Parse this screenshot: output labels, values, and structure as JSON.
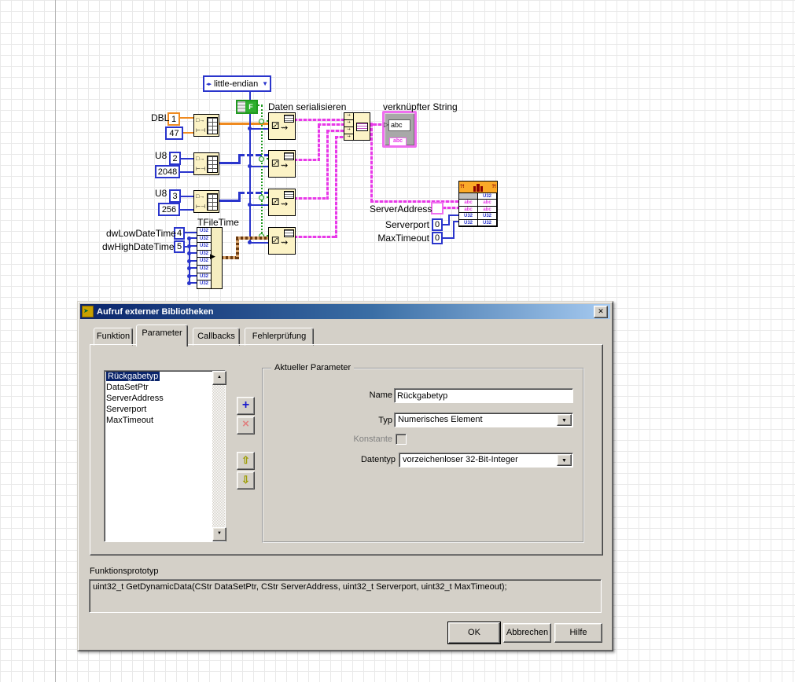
{
  "diagram": {
    "enum_value": "little-endian",
    "bool_value": "F",
    "labels": {
      "serialize": "Daten serialisieren",
      "indicator": "verknüpfter String",
      "cluster": "TFileTime",
      "dbl": "DBL",
      "u8_a": "U8",
      "u8_b": "U8",
      "low": "dwLowDateTime",
      "high": "dwHighDateTime",
      "server_address": "ServerAddress",
      "serverport": "Serverport",
      "max_timeout": "MaxTimeout"
    },
    "constants": {
      "idx1": "1",
      "val1": "47",
      "idx2": "2",
      "val2": "2048",
      "idx3": "3",
      "val3": "256",
      "idx4": "4",
      "idx5": "5",
      "serverport": "0",
      "max_timeout": "0"
    },
    "cluster_cell": "U32",
    "indicator": {
      "value": "abc",
      "tag": "abc"
    },
    "clfn": {
      "marks_left": "?!",
      "marks_right": "?!",
      "cells": [
        [
          "",
          "U32"
        ],
        [
          "abc",
          "abc"
        ],
        [
          "abc",
          "abc"
        ],
        [
          "U32",
          "U32"
        ],
        [
          "U32",
          "U32"
        ]
      ]
    }
  },
  "dialog": {
    "title": "Aufruf externer Bibliotheken",
    "tabs": [
      "Funktion",
      "Parameter",
      "Callbacks",
      "Fehlerprüfung"
    ],
    "param_list": [
      "Rückgabetyp",
      "DataSetPtr",
      "ServerAddress",
      "Serverport",
      "MaxTimeout"
    ],
    "group_title": "Aktueller Parameter",
    "name_label": "Name",
    "name_value": "Rückgabetyp",
    "typ_label": "Typ",
    "typ_value": "Numerisches Element",
    "konstante_label": "Konstante",
    "datentyp_label": "Datentyp",
    "datentyp_value": "vorzeichenloser 32-Bit-Integer",
    "prototype_label": "Funktionsprototyp",
    "prototype_text": "uint32_t GetDynamicData(CStr DataSetPtr, CStr ServerAddress, uint32_t Serverport, uint32_t MaxTimeout);",
    "ok": "OK",
    "cancel": "Abbrechen",
    "help": "Hilfe"
  },
  "icons": {
    "close": "✕",
    "combo_arrow": "▼",
    "scroll_up": "▲",
    "scroll_down": "▼",
    "add": "+",
    "remove": "×",
    "move_up": "⇧",
    "move_down": "⇩",
    "enum_nav": "◂▸",
    "enum_arrow": "▼",
    "dice": "⚂",
    "squiggle": "⇝",
    "init_in": "□→",
    "init_idx": "⊢⊣",
    "concat_cell": "▫+",
    "string_marker": "▷",
    "bundle_arrow": "▶",
    "title_glyph": "➤"
  },
  "colors": {
    "string_wire": "#e83ae8",
    "int_wire": "#2a35cc",
    "dbl_wire": "#ef8a1f",
    "bool_wire": "#1f9a1f",
    "cluster_wire": "#6b3a10",
    "titlebar": "#0a246a",
    "dialog_bg": "#d4d0c8",
    "selection": "#0a246a",
    "node_bg": "#fcf3c6",
    "clfn_header": "#fbaa28"
  }
}
